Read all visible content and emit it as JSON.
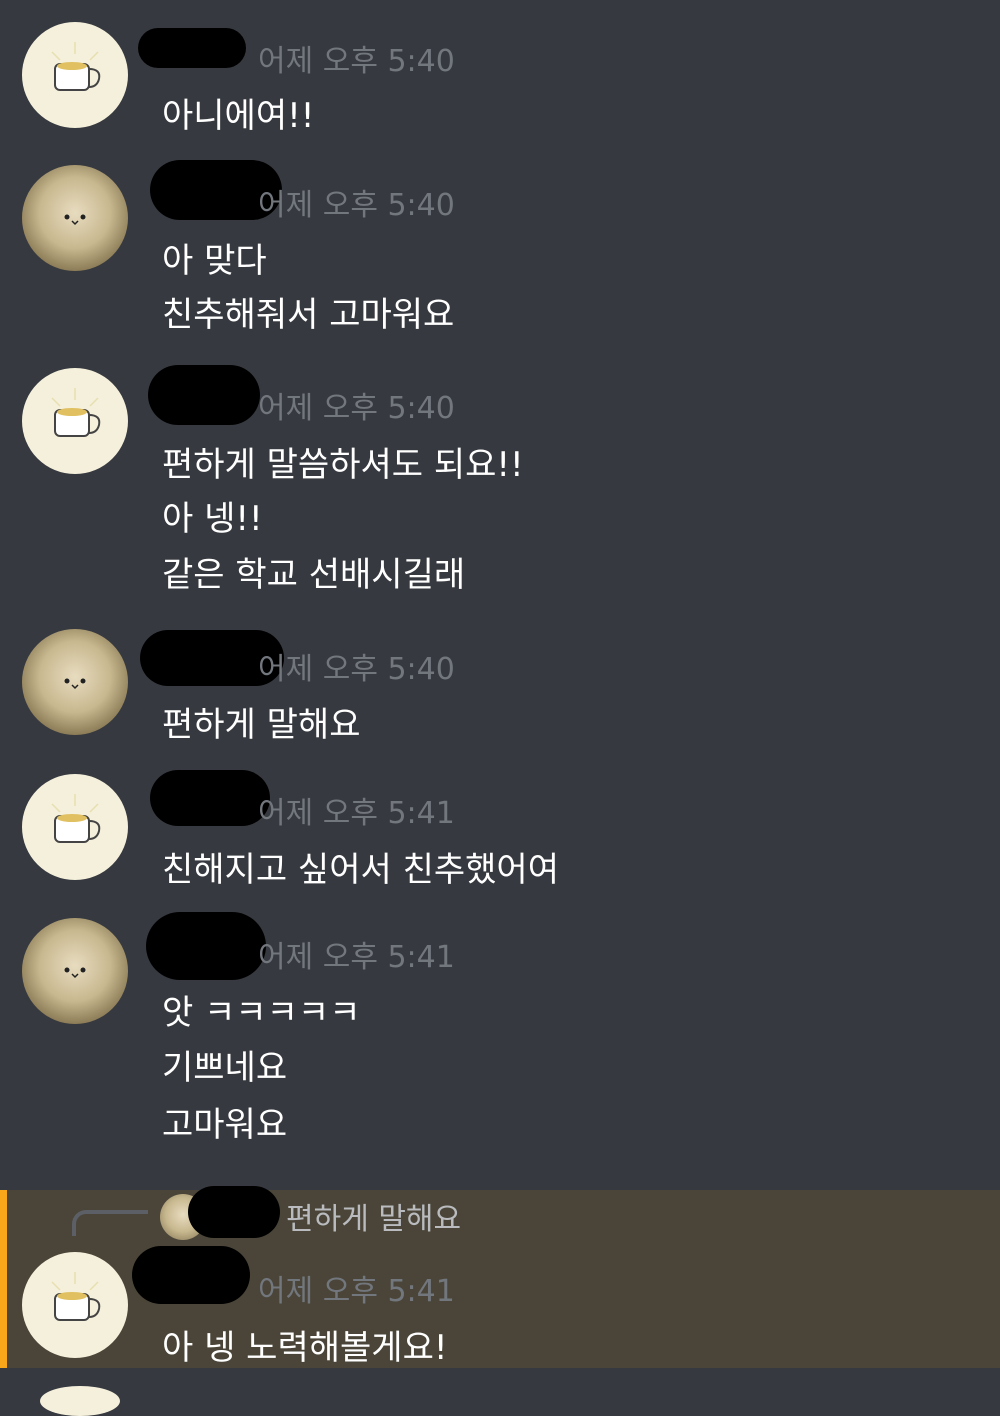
{
  "messages": [
    {
      "avatar": "cup-avatar",
      "timestamp": "어제 오후 5:40",
      "lines": [
        "아니에여!!"
      ]
    },
    {
      "avatar": "cat-avatar",
      "timestamp": "어제 오후 5:40",
      "lines": [
        "아 맞다",
        "친추해줘서 고마워요"
      ]
    },
    {
      "avatar": "cup-avatar",
      "timestamp": "어제 오후 5:40",
      "lines": [
        "편하게 말씀하셔도 되요!!",
        "아 넹!!",
        "같은 학교 선배시길래"
      ]
    },
    {
      "avatar": "cat-avatar",
      "timestamp": "어제 오후 5:40",
      "lines": [
        "편하게 말해요"
      ]
    },
    {
      "avatar": "cup-avatar",
      "timestamp": "어제 오후 5:41",
      "lines": [
        "친해지고 싶어서 친추했어여"
      ]
    },
    {
      "avatar": "cat-avatar",
      "timestamp": "어제 오후 5:41",
      "lines": [
        "앗 ㅋㅋㅋㅋㅋ",
        "기쁘네요",
        "고마워요"
      ]
    }
  ],
  "reply": {
    "quoted_text": "편하게 말해요",
    "timestamp": "어제 오후 5:41",
    "line": "아 넹 노력해볼게요!"
  },
  "colors": {
    "background": "#36393f",
    "highlight": "#4a4538",
    "highlight_bar": "#faa61a",
    "timestamp": "#72767d",
    "text": "#ffffff"
  }
}
